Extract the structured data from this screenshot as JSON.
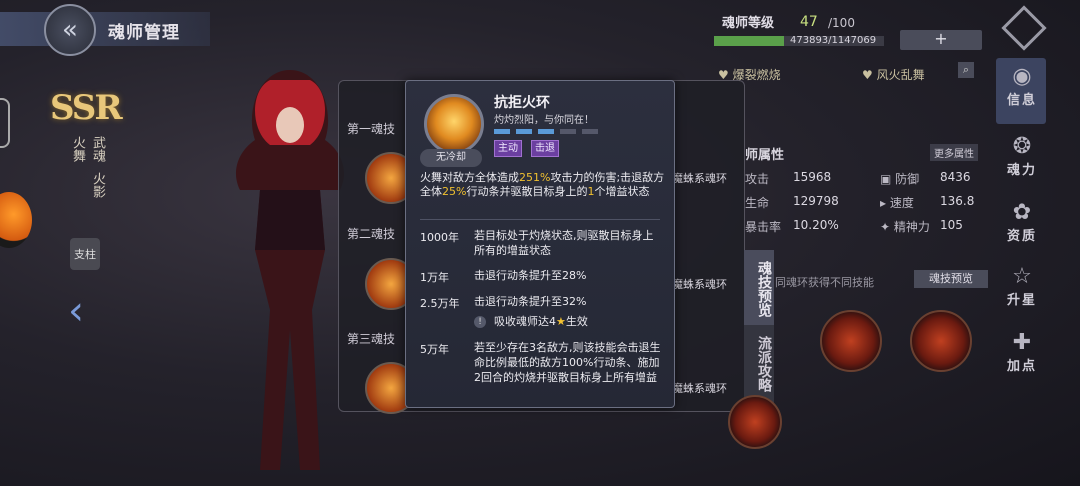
{
  "header": {
    "title": "魂师管理",
    "back_icon": "back-chevron-icon"
  },
  "character": {
    "rarity": "SSR",
    "name_a": "火舞",
    "name_b": "武魂",
    "name_c": "火影",
    "role_tag": "支柱"
  },
  "skill_panel": {
    "skill1_label": "第一魂技",
    "skill2_label": "第二魂技",
    "skill3_label": "第三魂技",
    "ring_label": "魔蛛系魂环"
  },
  "popup": {
    "skill_name": "抗拒火环",
    "quote": "灼灼烈阳，与你同在！",
    "cooldown": "无冷却",
    "tags": [
      "主动",
      "击退"
    ],
    "desc_1": "火舞对敌方全体造成",
    "desc_pct1": "251%",
    "desc_2": "攻击力的伤害;击退敌方全体",
    "desc_pct2": "25%",
    "desc_3": "行动条并驱散目标身上的",
    "desc_num": "1",
    "desc_4": "个增益状态",
    "upgrades": [
      {
        "year": "1000年",
        "text": "若目标处于灼烧状态,则驱散目标身上所有的增益状态"
      },
      {
        "year": "1万年",
        "text": "击退行动条提升至28%"
      },
      {
        "year": "2.5万年",
        "text": "击退行动条提升至32%"
      },
      {
        "year": "5万年",
        "text": "若至少存在3名敌方,则该技能会击退生命比例最低的敌方100%行动条、施加2回合的灼烧并驱散目标身上所有增益"
      }
    ],
    "condition_pre": "吸收魂师达4",
    "condition_post": "生效"
  },
  "stats_panel": {
    "level_label": "魂师等级",
    "level": "47",
    "level_max": "/100",
    "xp_text": "473893/1147069",
    "xp_fraction": 0.413,
    "plus": "+",
    "trait1": "爆裂燃烧",
    "trait2": "风火乱舞",
    "section_title": "师属性",
    "more_label": "更多属性",
    "stats": [
      {
        "label": "攻击",
        "value": "15968"
      },
      {
        "label": "防御",
        "value": "8436"
      },
      {
        "label": "生命",
        "value": "129798"
      },
      {
        "label": "速度",
        "value": "136.8"
      },
      {
        "label": "暴击率",
        "value": "10.20%"
      },
      {
        "label": "精神力",
        "value": "105"
      }
    ],
    "tab_preview": "魂技预览",
    "tab_strategy": "流派攻略",
    "preview_hint": "同魂环获得不同技能",
    "preview_button": "魂技预览"
  },
  "sidebar": {
    "items": [
      {
        "label": "信息",
        "icon": "info-icon"
      },
      {
        "label": "魂力",
        "icon": "soul-power-icon"
      },
      {
        "label": "资质",
        "icon": "aptitude-icon"
      },
      {
        "label": "升星",
        "icon": "star-up-icon"
      },
      {
        "label": "加点",
        "icon": "add-point-icon"
      }
    ]
  },
  "colors": {
    "highlight": "#f0c030",
    "tag": "#6b3fa0",
    "xp": "#5aa04a"
  }
}
